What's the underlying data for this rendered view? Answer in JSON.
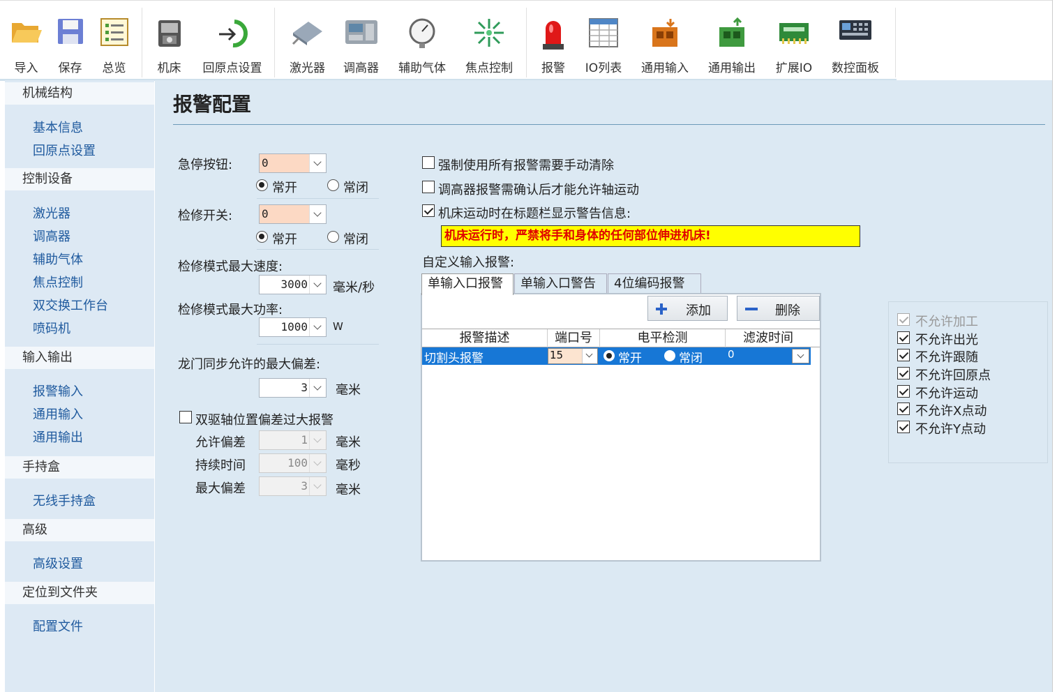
{
  "toolbar": {
    "items": [
      {
        "label": "导入",
        "icon": "folder-open-icon"
      },
      {
        "label": "保存",
        "icon": "floppy-disk-icon"
      },
      {
        "label": "总览",
        "icon": "list-overview-icon"
      },
      {
        "label": "机床",
        "icon": "machine-icon"
      },
      {
        "label": "回原点设置",
        "icon": "return-origin-icon"
      },
      {
        "label": "激光器",
        "icon": "laser-icon"
      },
      {
        "label": "调高器",
        "icon": "height-controller-icon"
      },
      {
        "label": "辅助气体",
        "icon": "gas-gauge-icon"
      },
      {
        "label": "焦点控制",
        "icon": "focus-control-icon"
      },
      {
        "label": "报警",
        "icon": "alarm-light-icon"
      },
      {
        "label": "IO列表",
        "icon": "io-table-icon"
      },
      {
        "label": "通用输入",
        "icon": "general-input-icon"
      },
      {
        "label": "通用输出",
        "icon": "general-output-icon"
      },
      {
        "label": "扩展IO",
        "icon": "extension-io-icon"
      },
      {
        "label": "数控面板",
        "icon": "cnc-panel-icon"
      }
    ]
  },
  "sidebar": {
    "groups": [
      {
        "title": "机械结构",
        "items": [
          "基本信息",
          "回原点设置"
        ]
      },
      {
        "title": "控制设备",
        "items": [
          "激光器",
          "调高器",
          "辅助气体",
          "焦点控制",
          "双交换工作台",
          "喷码机"
        ]
      },
      {
        "title": "输入输出",
        "items": [
          "报警输入",
          "通用输入",
          "通用输出"
        ]
      },
      {
        "title": "手持盒",
        "items": [
          "无线手持盒"
        ]
      },
      {
        "title": "高级",
        "items": [
          "高级设置"
        ]
      },
      {
        "title": "定位到文件夹",
        "items": [
          "配置文件"
        ]
      }
    ]
  },
  "page": {
    "title": "报警配置"
  },
  "left_form": {
    "estop": {
      "label": "急停按钮:",
      "value": "0",
      "normally_open": "常开",
      "normally_closed": "常闭",
      "selected": "常开"
    },
    "maintenance_switch": {
      "label": "检修开关:",
      "value": "0",
      "normally_open": "常开",
      "normally_closed": "常闭",
      "selected": "常开"
    },
    "max_speed": {
      "label": "检修模式最大速度:",
      "value": "3000",
      "unit": "毫米/秒"
    },
    "max_power": {
      "label": "检修模式最大功率:",
      "value": "1000",
      "unit": "W"
    },
    "gantry": {
      "label": "龙门同步允许的最大偏差:",
      "value": "3",
      "unit": "毫米"
    },
    "dual_drive": {
      "label": "双驱轴位置偏差过大报警",
      "checked": false,
      "allow_dev": {
        "label": "允许偏差",
        "value": "1",
        "unit": "毫米"
      },
      "duration": {
        "label": "持续时间",
        "value": "100",
        "unit": "毫秒"
      },
      "max_dev": {
        "label": "最大偏差",
        "value": "3",
        "unit": "毫米"
      }
    }
  },
  "right_form": {
    "opt1": {
      "label": "强制使用所有报警需要手动清除",
      "checked": false
    },
    "opt2": {
      "label": "调高器报警需确认后才能允许轴运动",
      "checked": false
    },
    "opt3": {
      "label": "机床运动时在标题栏显示警告信息:",
      "checked": true
    },
    "warning_text": "机床运行时，严禁将手和身体的任何部位伸进机床!",
    "custom_label": "自定义输入报警:",
    "tabs": [
      "单输入口报警",
      "单输入口警告",
      "4位编码报警"
    ],
    "active_tab": 0,
    "add_button": "添加",
    "delete_button": "删除",
    "columns": [
      "报警描述",
      "端口号",
      "电平检测",
      "滤波时间"
    ],
    "rows": [
      {
        "desc": "切割头报警",
        "port": "15",
        "open": "常开",
        "closed": "常闭",
        "selected": "常开",
        "filter": "0"
      }
    ]
  },
  "restrictions": [
    {
      "label": "不允许加工",
      "checked": true,
      "disabled": true
    },
    {
      "label": "不允许出光",
      "checked": true,
      "disabled": false
    },
    {
      "label": "不允许跟随",
      "checked": true,
      "disabled": false
    },
    {
      "label": "不允许回原点",
      "checked": true,
      "disabled": false
    },
    {
      "label": "不允许运动",
      "checked": true,
      "disabled": false
    },
    {
      "label": "不允许X点动",
      "checked": true,
      "disabled": false
    },
    {
      "label": "不允许Y点动",
      "checked": true,
      "disabled": false
    }
  ]
}
